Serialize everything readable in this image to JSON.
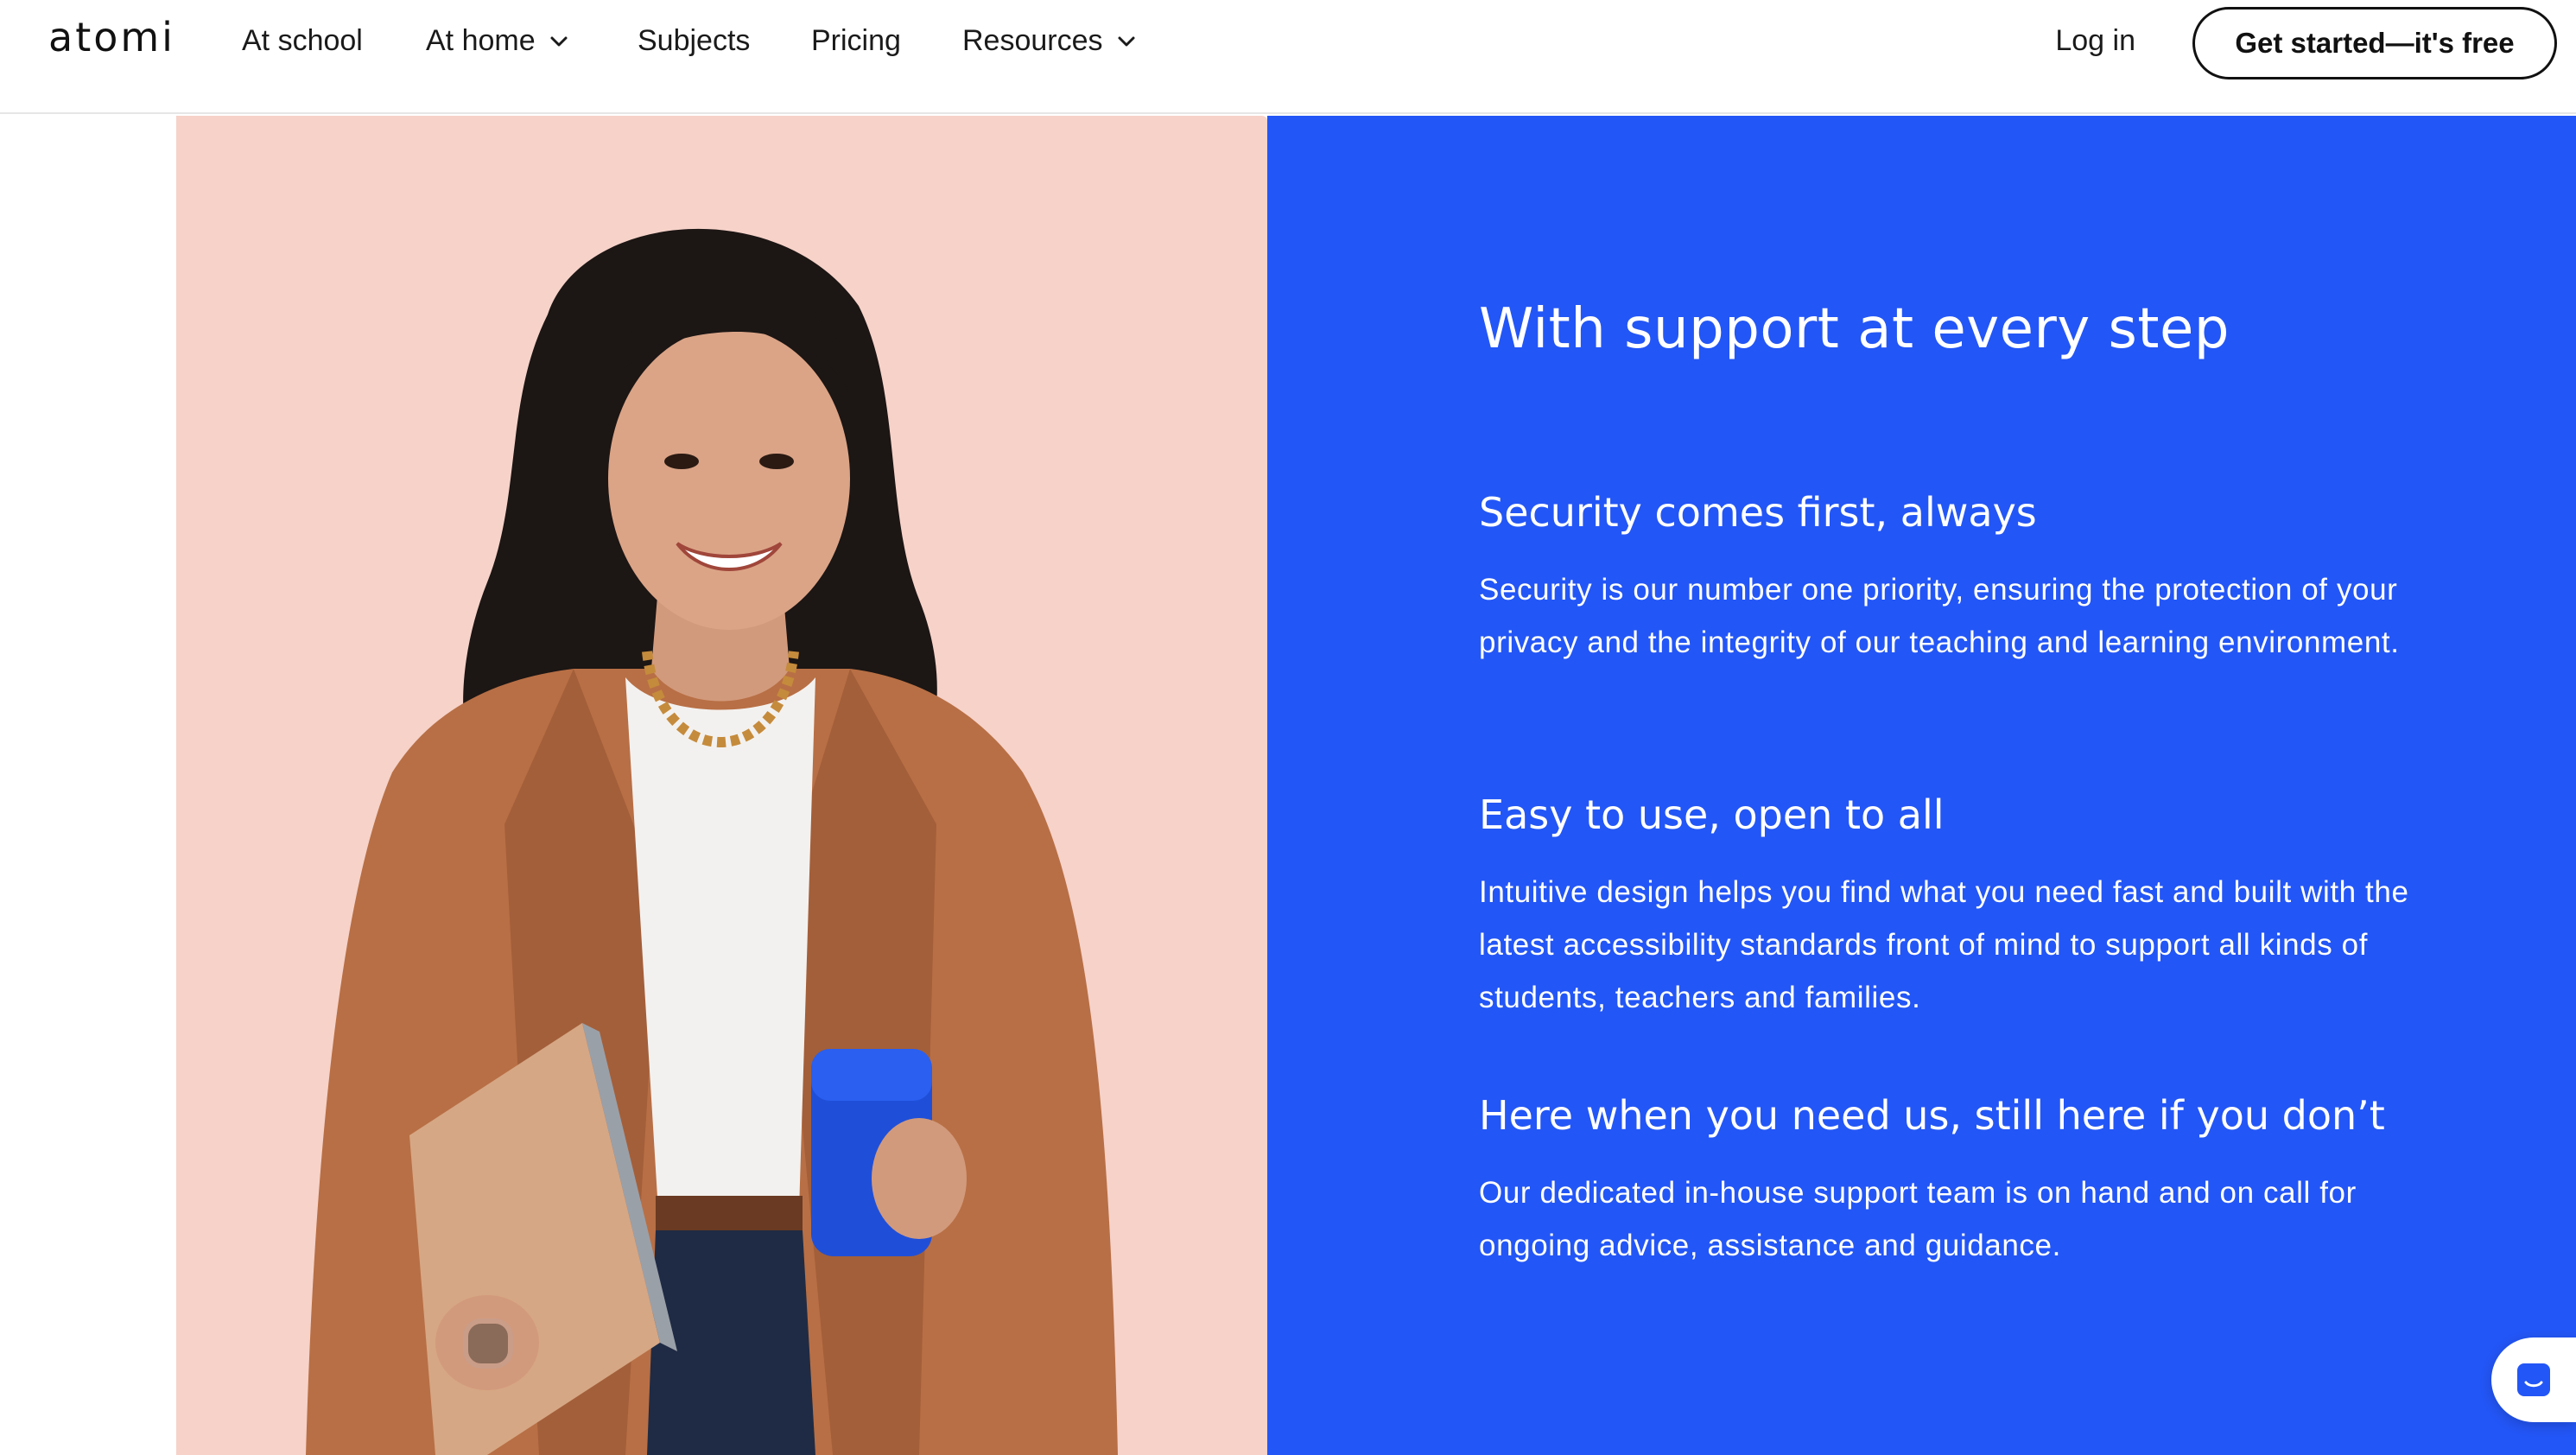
{
  "nav": {
    "logo": "atomi",
    "items": [
      {
        "label": "At school",
        "has_dropdown": false
      },
      {
        "label": "At home",
        "has_dropdown": true
      },
      {
        "label": "Subjects",
        "has_dropdown": false
      },
      {
        "label": "Pricing",
        "has_dropdown": false
      },
      {
        "label": "Resources",
        "has_dropdown": true
      }
    ],
    "login_label": "Log in",
    "cta_label": "Get started—it's free"
  },
  "hero_image": {
    "icon": "person-photo",
    "background_color": "#f6d2c9"
  },
  "section": {
    "background_color": "#2356f6",
    "heading": "With support at every step",
    "features": [
      {
        "title": "Security comes first, always",
        "body": "Security is our number one priority, ensuring the protection of your privacy and the integrity of our teaching and learning environment."
      },
      {
        "title": "Easy to use, open to all",
        "body": "Intuitive design helps you find what you need fast and built with the latest accessibility standards front of mind to support all kinds of students, teachers and families."
      },
      {
        "title": "Here when you need us, still here if you don’t",
        "body": "Our dedicated in-house support team is on hand and on call for ongoing advice, assistance and guidance."
      }
    ]
  },
  "chat_widget": {
    "icon": "chat-icon"
  }
}
